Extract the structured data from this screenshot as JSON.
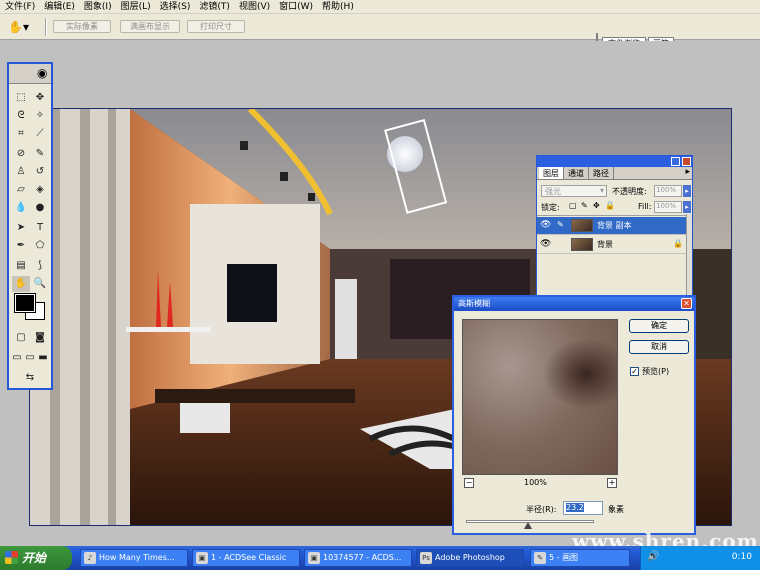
{
  "menubar": {
    "items": [
      "文件(F)",
      "编辑(E)",
      "图象(I)",
      "图层(L)",
      "选择(S)",
      "滤镜(T)",
      "视图(V)",
      "窗口(W)",
      "帮助(H)"
    ]
  },
  "options_bar": {
    "buttons": [
      "实际像素",
      "满画布显示",
      "打印尺寸"
    ],
    "palette_tabs": [
      "文件浏览",
      "画笔"
    ]
  },
  "layers_palette": {
    "tabs": [
      "图层",
      "通道",
      "路径"
    ],
    "blend_mode": "强光",
    "opacity_label": "不透明度:",
    "opacity_value": "100%",
    "lock_label": "锁定:",
    "fill_label": "Fill:",
    "fill_value": "100%",
    "layers": [
      {
        "name": "背景 副本",
        "selected": true
      },
      {
        "name": "背景",
        "selected": false
      }
    ]
  },
  "blur_dialog": {
    "title": "高斯模糊",
    "ok": "确定",
    "cancel": "取消",
    "preview_label": "预览(P)",
    "preview_checked": "✓",
    "zoom": "100%",
    "zoom_out": "−",
    "zoom_in": "+",
    "radius_label": "半径(R):",
    "radius_value": "23.2",
    "radius_unit": "象素"
  },
  "taskbar": {
    "start": "开始",
    "tasks": [
      {
        "label": "How Many Times..."
      },
      {
        "label": "1 - ACDSee Classic"
      },
      {
        "label": "10374577 - ACDS..."
      },
      {
        "label": "Adobe Photoshop"
      },
      {
        "label": "5 - 画图"
      }
    ],
    "clock": "0:10"
  },
  "watermark": "www.shren.com",
  "colors": {
    "xp_blue": "#2558d8",
    "selection": "#3169c6",
    "taskbar": "#245edb"
  }
}
